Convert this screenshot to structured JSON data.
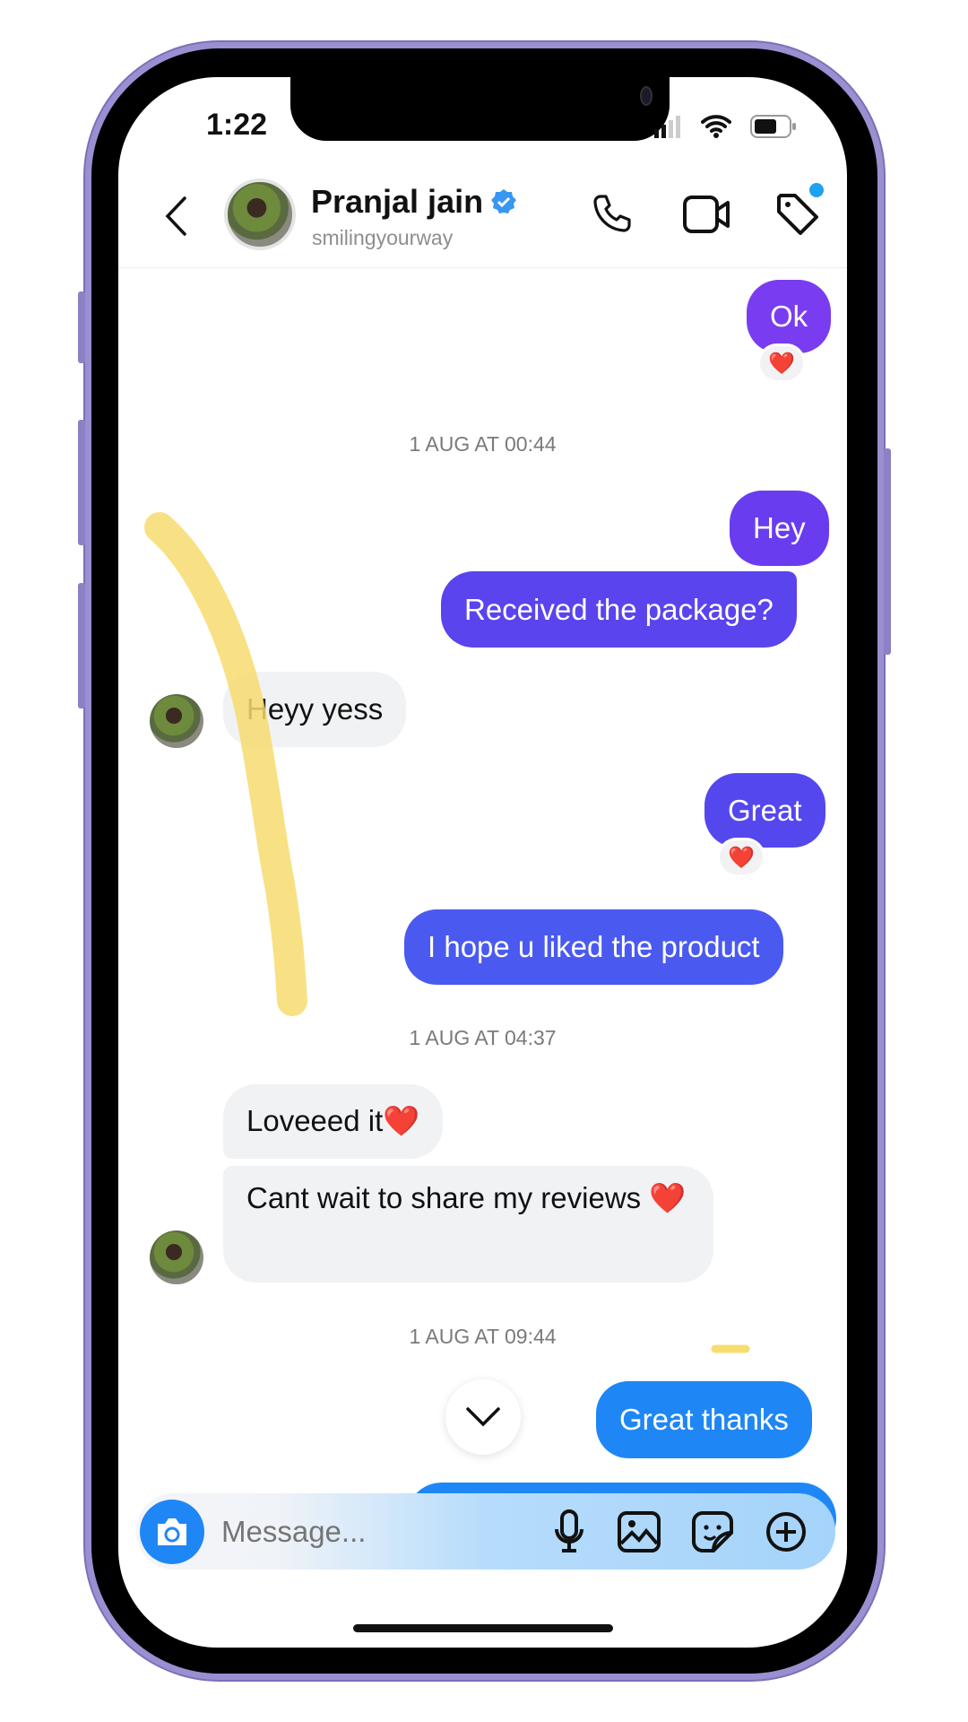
{
  "status_bar": {
    "time": "1:22"
  },
  "header": {
    "name": "Pranjal jain",
    "username": "smilingyourway",
    "verified": true,
    "icons": [
      "back-chevron-icon",
      "phone-icon",
      "video-camera-icon",
      "tag-icon"
    ],
    "notification_dot_color": "#1da1f2"
  },
  "messages": [
    {
      "side": "sent",
      "text": "Ok",
      "reaction": "❤️"
    },
    {
      "type": "timestamp",
      "text": "1 AUG AT 00:44"
    },
    {
      "side": "sent",
      "text": "Hey"
    },
    {
      "side": "sent",
      "text": "Received the package?"
    },
    {
      "side": "received",
      "text": "Heyy yess"
    },
    {
      "side": "sent",
      "text": "Great",
      "reaction": "❤️"
    },
    {
      "side": "sent",
      "text": "I hope u liked the product"
    },
    {
      "type": "timestamp",
      "text": "1 AUG AT 04:37"
    },
    {
      "side": "received",
      "text": "Loveeed it❤️"
    },
    {
      "side": "received",
      "text": "Cant wait to share my reviews ❤️"
    },
    {
      "type": "timestamp",
      "text": "1 AUG AT 09:44"
    },
    {
      "side": "sent",
      "text": "Great thanks"
    }
  ],
  "composer": {
    "placeholder": "Message...",
    "icons": [
      "camera-icon",
      "microphone-icon",
      "gallery-icon",
      "sticker-icon",
      "plus-circle-icon"
    ]
  },
  "colors": {
    "sent_purple": "#7a3cf0",
    "sent_indigo": "#5547ee",
    "sent_blue": "#1f87f5",
    "received": "#f1f2f4",
    "highlighter": "#f7dc6f",
    "frame": "#9a8fd0"
  }
}
